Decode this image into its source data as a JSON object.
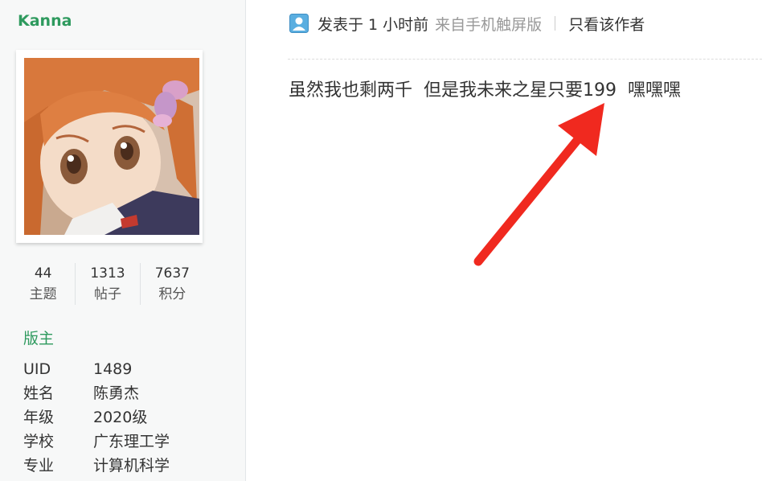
{
  "sidebar": {
    "username": "Kanna",
    "stats": [
      {
        "value": "44",
        "label": "主题"
      },
      {
        "value": "1313",
        "label": "帖子"
      },
      {
        "value": "7637",
        "label": "积分"
      }
    ],
    "role": "版主",
    "profile": [
      {
        "key": "UID",
        "value": "1489"
      },
      {
        "key": "姓名",
        "value": "陈勇杰"
      },
      {
        "key": "年级",
        "value": "2020级"
      },
      {
        "key": "学校",
        "value": "广东理工学"
      },
      {
        "key": "专业",
        "value": "计算机科学"
      }
    ]
  },
  "post": {
    "posted_time": "发表于 1 小时前",
    "source": "来自手机触屏版",
    "author_only_link": "只看该作者",
    "content": "虽然我也剩两千  但是我未来之星只要199  嘿嘿嘿"
  },
  "colors": {
    "accent_green": "#2e9a5e",
    "annotation_arrow": "#f0291f"
  },
  "icons": {
    "mobile_post": "user-icon",
    "annotation": "red-arrow-annotation"
  }
}
